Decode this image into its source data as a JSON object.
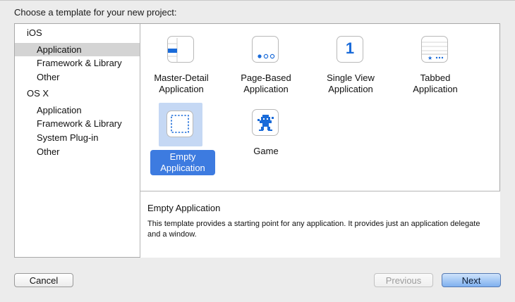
{
  "heading": "Choose a template for your new project:",
  "sidebar": {
    "groups": [
      {
        "label": "iOS",
        "items": [
          "Application",
          "Framework & Library",
          "Other"
        ],
        "selected_index": 0
      },
      {
        "label": "OS X",
        "items": [
          "Application",
          "Framework & Library",
          "System Plug-in",
          "Other"
        ],
        "selected_index": -1
      }
    ]
  },
  "templates": [
    {
      "line1": "Master-Detail",
      "line2": "Application",
      "icon": "master-detail-icon"
    },
    {
      "line1": "Page-Based",
      "line2": "Application",
      "icon": "page-based-icon"
    },
    {
      "line1": "Single View",
      "line2": "Application",
      "icon": "single-view-icon",
      "glyph": "1"
    },
    {
      "line1": "Tabbed",
      "line2": "Application",
      "icon": "tabbed-icon"
    },
    {
      "line1": "Empty",
      "line2": "Application",
      "icon": "empty-application-icon",
      "selected": true
    },
    {
      "line1": "Game",
      "line2": "",
      "icon": "game-icon"
    }
  ],
  "description": {
    "title": "Empty Application",
    "body": "This template provides a starting point for any application. It provides just an application delegate and a window."
  },
  "buttons": {
    "cancel": "Cancel",
    "previous": "Previous",
    "next": "Next"
  },
  "colors": {
    "selection_blue": "#3d7be0",
    "icon_blue": "#1a6bd9"
  }
}
